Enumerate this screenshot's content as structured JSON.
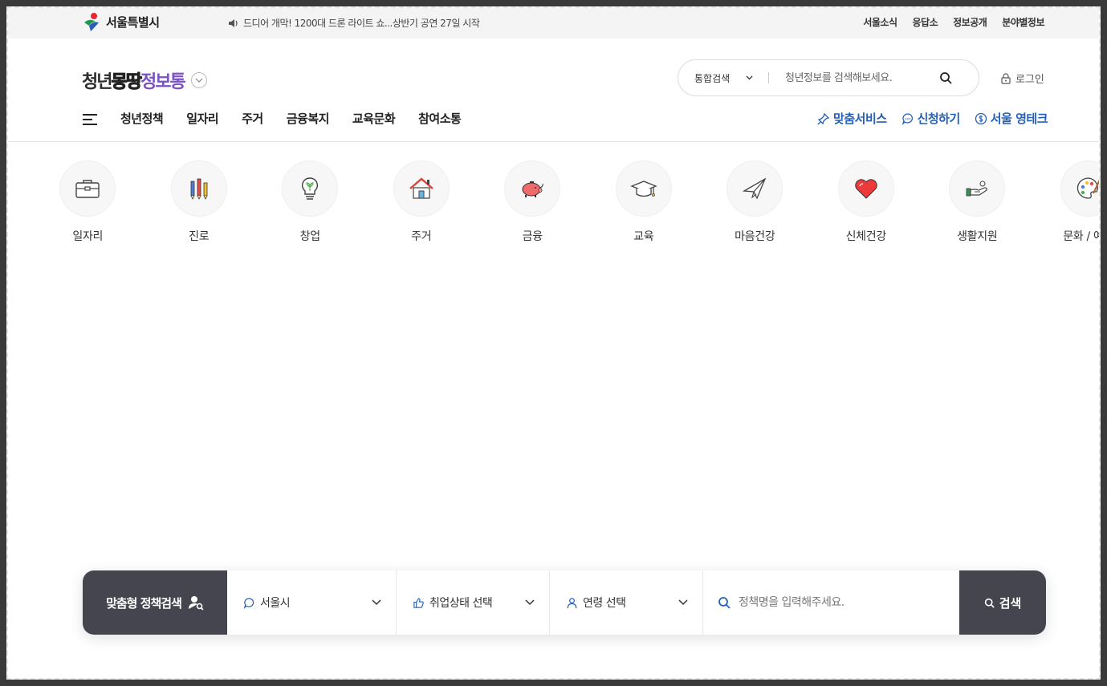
{
  "utility": {
    "city_name": "서울특별시",
    "notice": "드디어 개막! 1200대 드론 라이트 쇼...상반기 공연 27일 시작",
    "links": [
      "서울소식",
      "응답소",
      "정보공개",
      "분야별정보"
    ]
  },
  "header": {
    "logo": {
      "part1": "청년",
      "part2": "몽땅",
      "part3": "정보통"
    },
    "search": {
      "category": "통합검색",
      "placeholder": "청년정보를 검색해보세요."
    },
    "login": "로그인"
  },
  "nav": {
    "items": [
      "청년정책",
      "일자리",
      "주거",
      "금융복지",
      "교육문화",
      "참여소통"
    ],
    "right": [
      "맞춤서비스",
      "신청하기",
      "서울 영테크"
    ]
  },
  "categories": [
    {
      "label": "일자리",
      "icon": "briefcase-icon"
    },
    {
      "label": "진로",
      "icon": "pencils-icon"
    },
    {
      "label": "창업",
      "icon": "lightbulb-icon"
    },
    {
      "label": "주거",
      "icon": "house-icon"
    },
    {
      "label": "금융",
      "icon": "piggy-bank-icon"
    },
    {
      "label": "교육",
      "icon": "graduation-cap-icon"
    },
    {
      "label": "마음건강",
      "icon": "paper-plane-icon"
    },
    {
      "label": "신체건강",
      "icon": "heart-icon"
    },
    {
      "label": "생활지원",
      "icon": "hand-icon"
    },
    {
      "label": "문화 / 예술",
      "icon": "palette-icon"
    }
  ],
  "custom_search": {
    "title": "맞춤형 정책검색",
    "region": "서울시",
    "employment": "취업상태 선택",
    "age": "연령 선택",
    "placeholder": "정책명을 입력해주세요.",
    "button": "검색"
  },
  "colors": {
    "accent_blue": "#2460b8",
    "dark_panel": "#45454f",
    "logo_purple": "#7b52c4",
    "logo_green": "#4caf7f"
  }
}
